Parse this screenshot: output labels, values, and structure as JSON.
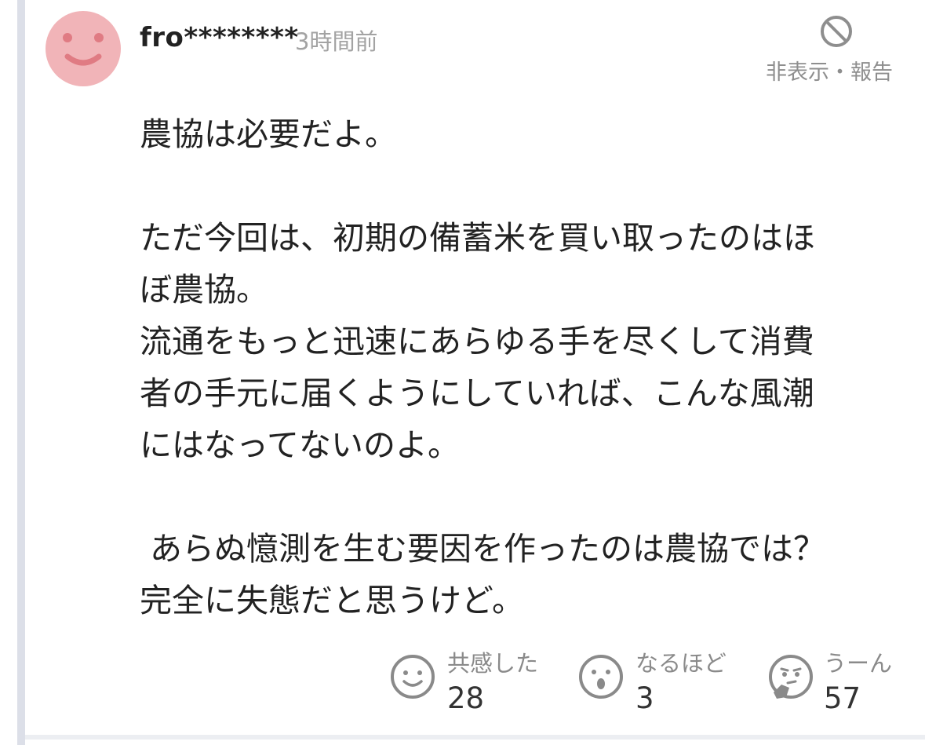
{
  "comment": {
    "username": "fro********",
    "timestamp": "3時間前",
    "hide_report_label": "非表示・報告",
    "paragraphs": [
      [
        "農協は必要だよ。"
      ],
      [
        "ただ今回は、初期の備蓄米を買い取ったのはほ",
        "ぼ農協。",
        "流通をもっと迅速にあらゆる手を尽くして消費",
        "者の手元に届くようにしていれば、こんな風潮",
        "にはなってないのよ。"
      ],
      [
        " あらぬ憶測を生む要因を作ったのは農協では？",
        "完全に失態だと思うけど。"
      ]
    ]
  },
  "reactions": [
    {
      "label": "共感した",
      "count": "28",
      "icon": "smile-face-icon"
    },
    {
      "label": "なるほど",
      "count": "3",
      "icon": "surprised-face-icon"
    },
    {
      "label": "うーん",
      "count": "57",
      "icon": "thinking-face-icon"
    }
  ],
  "colors": {
    "avatar": "#f1b4b8",
    "avatar_features": "#e07b83",
    "muted_text": "#a3a3a3",
    "icon_gray": "#8a8a8a"
  }
}
